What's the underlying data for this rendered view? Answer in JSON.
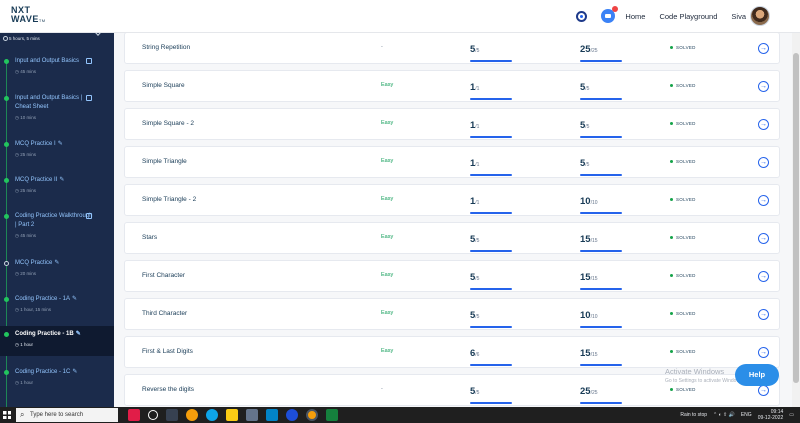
{
  "header": {
    "logo_line1": "NXT",
    "logo_line2": "WAVE",
    "logo_tm": "TM",
    "home_label": "Home",
    "playground_label": "Code Playground",
    "user_name": "Siva"
  },
  "sidebar": {
    "total_time": "5 hours, 5 mins",
    "items": [
      {
        "title": "Input and Output Basics",
        "duration": "45 mins",
        "icon": "document-icon",
        "completed": true
      },
      {
        "title": "Input and Output Basics | Cheat Sheet",
        "duration": "10 mins",
        "icon": "document-icon",
        "completed": true
      },
      {
        "title": "MCQ Practice I",
        "duration": "25 mins",
        "icon": "pencil-icon",
        "completed": true
      },
      {
        "title": "MCQ Practice II",
        "duration": "25 mins",
        "icon": "pencil-icon",
        "completed": true
      },
      {
        "title": "Coding Practice Walkthrough | Part 2",
        "duration": "45 mins",
        "icon": "document-icon",
        "completed": true
      },
      {
        "title": "MCQ Practice",
        "duration": "20 mins",
        "icon": "pencil-icon",
        "completed": false
      },
      {
        "title": "Coding Practice - 1A",
        "duration": "1 hour, 15 mins",
        "icon": "pencil-icon",
        "completed": true
      },
      {
        "title": "Coding Practice - 1B",
        "duration": "1 hour",
        "icon": "pencil-icon",
        "completed": true,
        "active": true
      },
      {
        "title": "Coding Practice - 1C",
        "duration": "1 hour",
        "icon": "pencil-icon",
        "completed": true
      }
    ]
  },
  "problems": [
    {
      "name": "String Repetition",
      "difficulty": "-",
      "tests": "5",
      "tests_total": "/5",
      "score": "25",
      "score_total": "/25",
      "status": "SOLVED"
    },
    {
      "name": "Simple Square",
      "difficulty": "Easy",
      "tests": "1",
      "tests_total": "/1",
      "score": "5",
      "score_total": "/5",
      "status": "SOLVED"
    },
    {
      "name": "Simple Square - 2",
      "difficulty": "Easy",
      "tests": "1",
      "tests_total": "/1",
      "score": "5",
      "score_total": "/5",
      "status": "SOLVED"
    },
    {
      "name": "Simple Triangle",
      "difficulty": "Easy",
      "tests": "1",
      "tests_total": "/1",
      "score": "5",
      "score_total": "/5",
      "status": "SOLVED"
    },
    {
      "name": "Simple Triangle - 2",
      "difficulty": "Easy",
      "tests": "1",
      "tests_total": "/1",
      "score": "10",
      "score_total": "/10",
      "status": "SOLVED"
    },
    {
      "name": "Stars",
      "difficulty": "Easy",
      "tests": "5",
      "tests_total": "/5",
      "score": "15",
      "score_total": "/15",
      "status": "SOLVED"
    },
    {
      "name": "First Character",
      "difficulty": "Easy",
      "tests": "5",
      "tests_total": "/5",
      "score": "15",
      "score_total": "/15",
      "status": "SOLVED"
    },
    {
      "name": "Third Character",
      "difficulty": "Easy",
      "tests": "5",
      "tests_total": "/5",
      "score": "10",
      "score_total": "/10",
      "status": "SOLVED"
    },
    {
      "name": "First & Last Digits",
      "difficulty": "Easy",
      "tests": "6",
      "tests_total": "/6",
      "score": "15",
      "score_total": "/15",
      "status": "SOLVED"
    },
    {
      "name": "Reverse the digits",
      "difficulty": "-",
      "tests": "5",
      "tests_total": "/5",
      "score": "25",
      "score_total": "/25",
      "status": "SOLVED"
    }
  ],
  "overlay": {
    "activate_title": "Activate Windows",
    "activate_sub": "Go to Settings to activate Windows.",
    "help_label": "Help"
  },
  "taskbar": {
    "search_placeholder": "Type here to search",
    "weather": "Rain to stop",
    "lang": "ENG",
    "time": "09:14",
    "date": "09-12-2022"
  }
}
